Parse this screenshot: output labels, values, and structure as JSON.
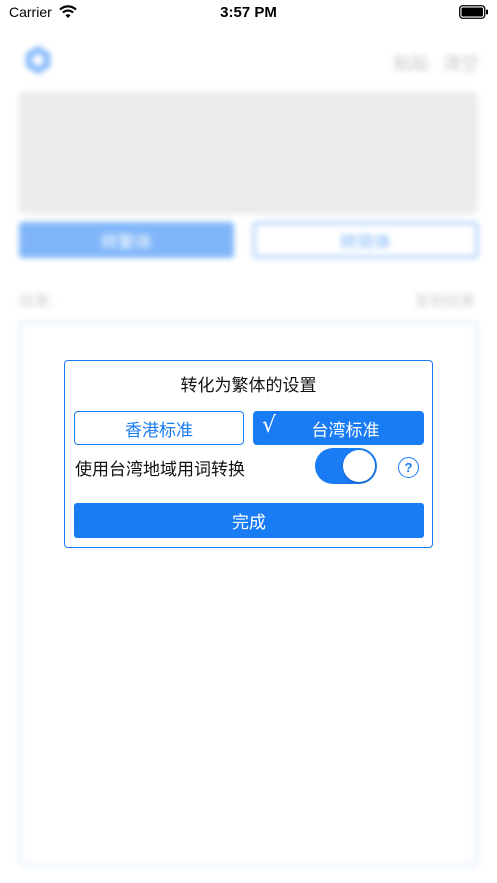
{
  "status_bar": {
    "carrier": "Carrier",
    "time": "3:57 PM"
  },
  "background": {
    "paste_label": "粘贴",
    "clear_label": "清空",
    "to_traditional_label": "转繁体",
    "to_simplified_label": "转简体",
    "result_label": "结果:",
    "copy_result_label": "复制结果"
  },
  "dialog": {
    "title": "转化为繁体的设置",
    "options": [
      {
        "label": "香港标准",
        "selected": false
      },
      {
        "label": "台湾标准",
        "selected": true
      }
    ],
    "check_mark": "√",
    "switch_label": "使用台湾地域用词转换",
    "switch_on": true,
    "help_glyph": "?",
    "done_label": "完成"
  },
  "colors": {
    "accent": "#1a7cf5"
  }
}
